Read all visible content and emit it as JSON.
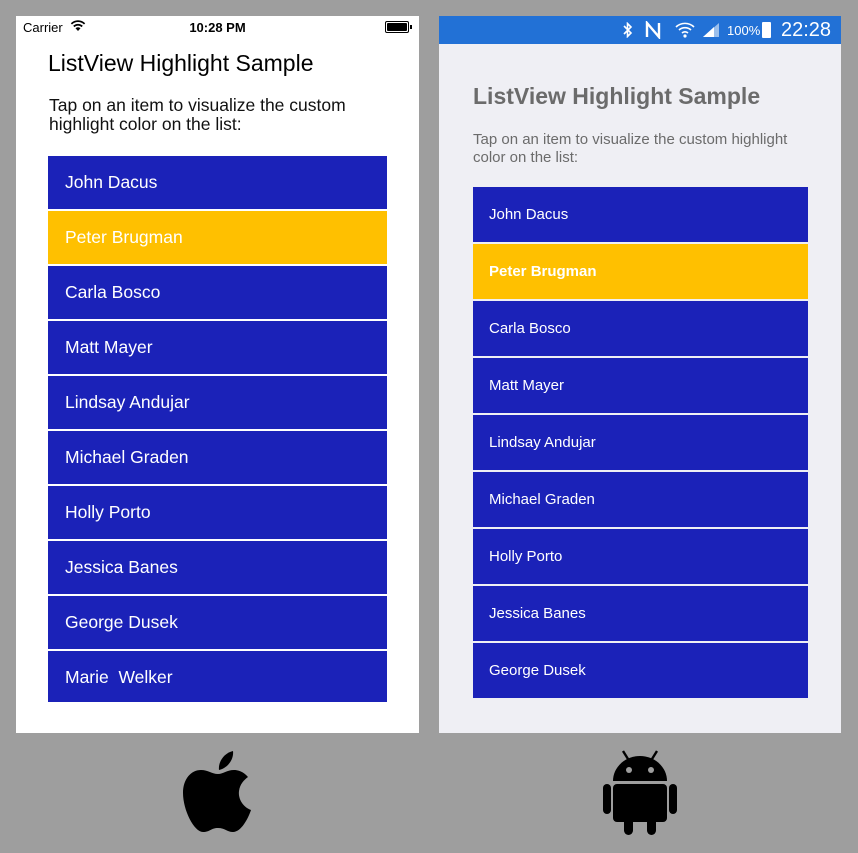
{
  "ios": {
    "status": {
      "carrier": "Carrier",
      "time": "10:28 PM"
    },
    "title": "ListView Highlight Sample",
    "subtitle": "Tap on an item to visualize the custom highlight color on the list:",
    "items": [
      "John Dacus",
      "Peter Brugman",
      "Carla Bosco",
      "Matt Mayer",
      "Lindsay Andujar",
      "Michael Graden",
      "Holly Porto",
      "Jessica Banes",
      "George Dusek",
      "Marie  Welker"
    ],
    "selected_item": "Peter Brugman"
  },
  "android": {
    "status": {
      "battery": "100%",
      "time": "22:28",
      "icons": [
        "bluetooth-icon",
        "nfc-icon",
        "wifi-icon",
        "signal-icon",
        "battery-icon"
      ]
    },
    "title": "ListView Highlight Sample",
    "subtitle": "Tap on an item to visualize the custom highlight color on the list:",
    "items": [
      "John Dacus",
      "Peter Brugman",
      "Carla Bosco",
      "Matt Mayer",
      "Lindsay Andujar",
      "Michael Graden",
      "Holly Porto",
      "Jessica Banes",
      "George Dusek"
    ],
    "selected_item": "Peter Brugman"
  },
  "logos": [
    "apple-logo",
    "android-logo"
  ],
  "colors": {
    "background": "#9e9e9e",
    "item": "#1b22b8",
    "highlight": "#ffc000",
    "android_statusbar": "#2271d6",
    "android_background": "#efeff4"
  }
}
